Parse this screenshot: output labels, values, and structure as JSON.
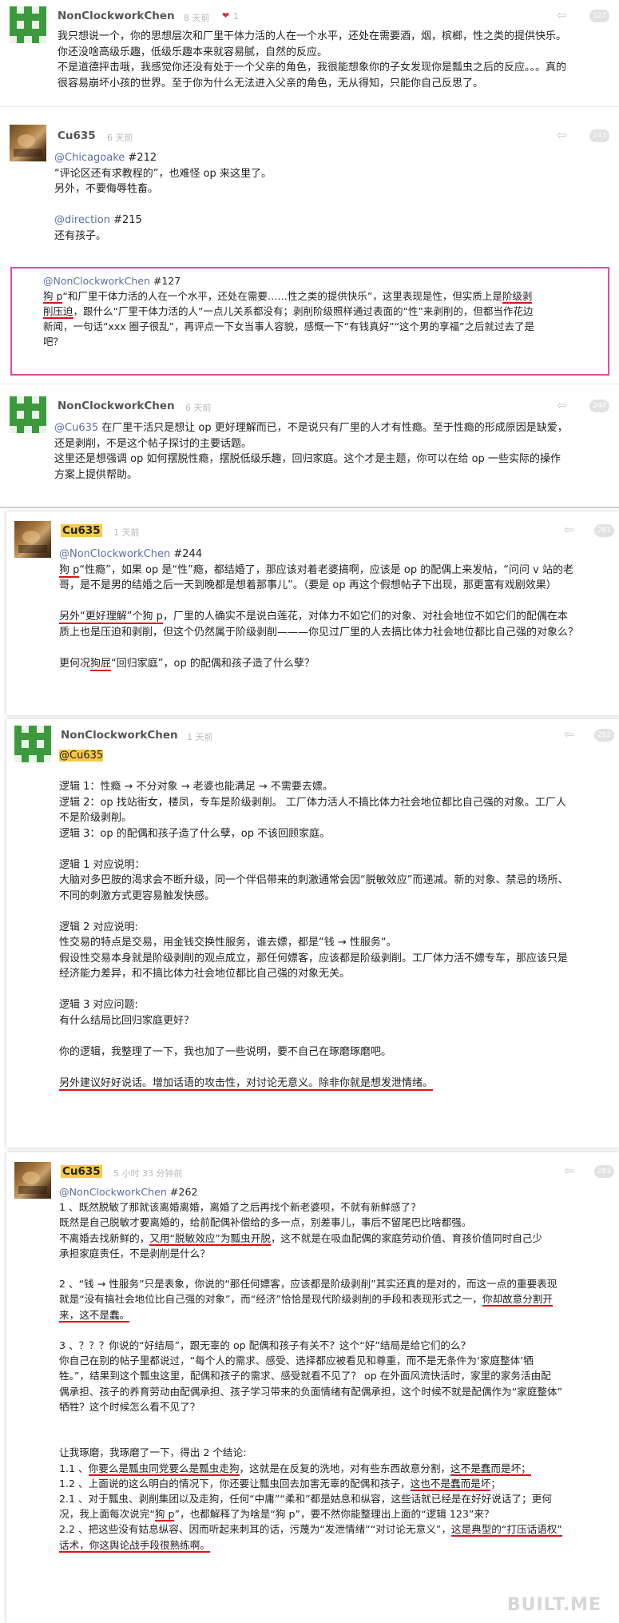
{
  "posts": [
    {
      "username": "NonClockworkChen",
      "time": "8 天前",
      "likes": "1",
      "badge": "127",
      "lines": [
        "我只想说一个，你的思想层次和厂里干体力活的人在一个水平，还处在需要酒，烟，槟榔，性之类的提供快乐。",
        "你还没啥高级乐趣，低级乐趣本来就容易腻，自然的反应。",
        "不是道德抨击哦，我感觉你还没有处于一个父亲的角色，我很能想象你的子女发现你是瓢虫之后的反应。。。真的",
        "很容易崩坏小孩的世界。至于你为什么无法进入父亲的角色，无从得知，只能你自己反思了。"
      ]
    },
    {
      "username": "Cu635",
      "time": "6 天前",
      "badge": "243",
      "mention1": "@Chicagoake",
      "ref1": " #212",
      "l1": "“评论区还有求教程的”，也难怪 op 来这里了。",
      "l2": "另外，不要侮辱牲畜。",
      "mention2": "@direction",
      "ref2": " #215",
      "l3": "还有孩子。",
      "mention3": "@NonClockworkChen",
      "ref3": " #127",
      "q1a": "狗 p",
      "q1b": "“和厂里干体力活的人在一个水平，还处在需要……性之类的提供快乐”，这里表现是性，但实质上是",
      "q1c": "阶级剥",
      "q2a": "削压迫",
      "q2b": "，跟什么“厂里干体力活的人”一点儿关系都没有；剥削阶级照样通过表面的“性”来剥削的，但都当作花边",
      "q3": "新闻，一句话“xxx 圈子很乱”，再评点一下女当事人容貌，感慨一下“有钱真好”“这个男的享福”之后就过去了是",
      "q4": "吧？"
    },
    {
      "username": "NonClockworkChen",
      "time": "6 天前",
      "badge": "244",
      "mention": "@Cu635",
      "l1": " 在厂里干活只是想让 op 更好理解而已，不是说只有厂里的人才有性瘾。至于性瘾的形成原因是缺爱，",
      "l2": "还是剥削，不是这个帖子探讨的主要话题。",
      "l3": "这里还是想强调 op 如何摆脱性瘾，摆脱低级乐趣，回归家庭。这个才是主题，你可以在给 op 一些实际的操作",
      "l4": "方案上提供帮助。"
    },
    {
      "username": "Cu635",
      "time": "1 天前",
      "badge": "261",
      "mention": "@NonClockworkChen",
      "ref": " #244",
      "a1a": "狗 p",
      "a1b": "“性瘾”，如果 op 是“性”瘾，都结婚了，那应该对着老婆搞啊，应该是 op 的配偶上来发帖，“问问 v 站的老",
      "a2": "哥，是不是男的结婚之后一天到晚都是想着那事儿”。（要是 op 再这个假想帖子下出现，那更富有戏剧效果）",
      "b1a": "另外“更好理解”个",
      "b1b": "狗 p",
      "b1c": "，厂里的人确实不是说白莲花，对体力不如它们的对象、对社会地位不如它们的配偶在本",
      "b2": "质上也是压迫和剥削，但这个仍然属于阶级剥削———你见过厂里的人去搞比体力社会地位都比自己强的对象么？",
      "c1a": "更何况",
      "c1b": "狗屁",
      "c1c": "“回归家庭”，op 的配偶和孩子造了什么孽？"
    },
    {
      "username": "NonClockworkChen",
      "time": "1 天前",
      "badge": "262",
      "mention": "@Cu635",
      "lines1": [
        "逻辑 1：性瘾 → 不分对象 → 老婆也能满足 → 不需要去嫖。",
        "逻辑 2：op 找站街女，楼凤，专车是阶级剥削。 工厂体力活人不搞比体力社会地位都比自己强的对象。工厂人",
        "不是阶级剥削。",
        "逻辑 3：op 的配偶和孩子造了什么孽，op 不该回顾家庭。"
      ],
      "lines2": [
        "逻辑 1 对应说明：",
        "大脑对多巴胺的渴求会不断升级，同一个伴侣带来的刺激通常会因“脱敏效应”而递减。新的对象、禁忌的场所、",
        "不同的刺激方式更容易触发快感。"
      ],
      "lines3": [
        "逻辑 2 对应说明:",
        "性交易的特点是交易，用金钱交换性服务，谁去嫖，都是“钱 → 性服务“。",
        "假设性交易本身就是阶级剥削的观点成立，那任何嫖客，应该都是阶级剥削。工厂体力活不嫖专车，那应该只是",
        "经济能力差异，和不搞比体力社会地位都比自己强的对象无关。"
      ],
      "lines4": [
        "逻辑 3 对应问题:",
        "有什么结局比回归家庭更好？"
      ],
      "l5": "你的逻辑，我整理了一下，我也加了一些说明，要不自己在琢磨琢磨吧。",
      "l6": "另外建议好好说话。增加话语的攻击性，对讨论无意义。除非你就是想发泄情绪。"
    },
    {
      "username": "Cu635",
      "time": "5 小时 33 分钟前",
      "badge": "263",
      "mention": "@NonClockworkChen",
      "ref": " #262",
      "p1": [
        "1 、既然脱敏了那就该离婚离婚，离婚了之后再找个新老婆呗，不就有新鲜感了？",
        "既然是自己脱敏才要离婚的，给前配偶补偿给的多一点，别差事儿，事后不留尾巴比啥都强。"
      ],
      "p1c1": "不离婚去找新鲜的，",
      "p1c2": "又用“脱敏效应”为瓢虫开脱",
      "p1c3": "，这不就是在吸血配偶的家庭劳动价值、育孩价值同时自己少",
      "p1d": "承担家庭责任，不是剥削是什么？",
      "p2a": "2 、“钱 → 性服务”只是表象，你说的“那任何嫖客，应该都是阶级剥削”其实还真的是对的，而这一点的重要表现",
      "p2b1": "就是“没有搞社会地位比自己强的对象”，而“经济”恰恰是现代阶级剥削的手段和表现形式之一，",
      "p2b2": "你却故意分割开",
      "p2c": "来，这不是蠢。",
      "p3": [
        "3 、？？？你说的“好结局”，跟无辜的 op 配偶和孩子有关不？这个“好”结局是给它们的么？",
        "你自己在别的帖子里都说过，“每个人的需求、感受、选择都应被看见和尊重，而不是无条件为‘家庭整体’牺",
        "牲。”，结果到这个瓢虫这里，配偶和孩子的需求、感受就看不见了？ op 在外面风流快活时，家里的家务活由配",
        "偶承担、孩子的养育劳动由配偶承担、孩子学习带来的负面情绪有配偶承担，这个时候不就是配偶作为“家庭整体”",
        "牺牲？这个时候怎么看不见了？"
      ],
      "p4": "让我琢磨，我琢磨了一下，得出 2 个结论:",
      "c11a": "1.1 、",
      "c11b": "你要么是瓢虫同党要么是瓢虫走狗",
      "c11c": "，这就是在反复的洗地，对有些东西故意分割，",
      "c11d": "这不是蠢而是坏；",
      "c12a": "1.2 、上面说的这么明白的情况下，你还要让瓢虫回去加害无辜的配偶和孩子，",
      "c12b": "这也不是蠢而是坏",
      "c12c": "；",
      "c21a": "2.1 、对于瓢虫、剥削集团以及走狗，任何“中庸”“柔和”都是姑息和纵容，这些话就已经是在好好说话了；更何",
      "c21b1": "况，我上面每次说完“",
      "c21b2": "狗 p",
      "c21b3": "”，也都解释了为啥是“狗 p”，要不然你能整理出上面的“逻辑 123”来？",
      "c22a": "2.2 、把这些没有姑息纵容、因而听起来刺耳的话，污蔑为“发泄情绪”“对讨论无意义”，",
      "c22b": "这是典型的“打压话语权”",
      "c22c": "话术，你这舆论战手段很熟练啊。"
    }
  ],
  "watermark": "BUILT.ME",
  "colors": {
    "highlight_yellow": "#f7c948",
    "underline_red": "#e0101a",
    "box_pink": "#e34aa8",
    "mention_blue": "#5a6fa0"
  },
  "icons": {
    "reply": "reply-arrow-icon",
    "heart": "heart-icon"
  }
}
